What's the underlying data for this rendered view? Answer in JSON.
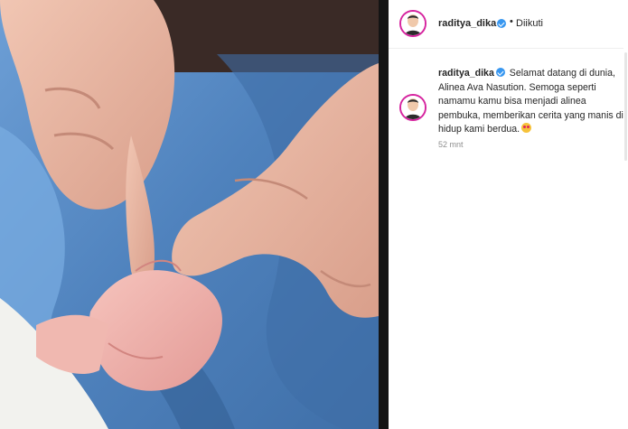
{
  "post": {
    "username": "raditya_dika",
    "follow_state": "Diikuti",
    "separator": "•",
    "caption_user": "raditya_dika",
    "caption_text": "Selamat datang di dunia, Alinea Ava Nasution. Semoga seperti namamu kamu bisa menjadi alinea pembuka, memberikan cerita yang manis di hidup kami berdua.",
    "timestamp": "52 mnt"
  },
  "icons": {
    "verified": "verified-badge-icon",
    "emoji": "heart-eyes-emoji-icon"
  },
  "colors": {
    "verified_blue": "#3897f0",
    "avatar_ring": "#d6249f",
    "muted_text": "#8e8e8e",
    "panel_divider": "#141414"
  }
}
